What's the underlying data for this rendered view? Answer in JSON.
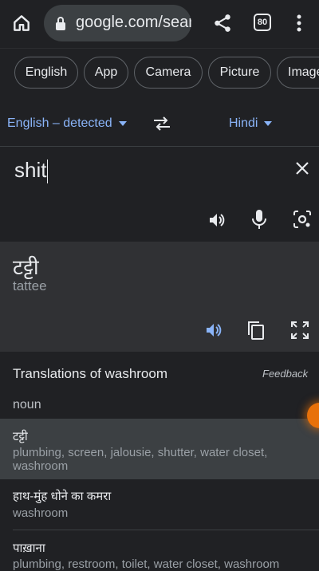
{
  "browser": {
    "url": "google.com/sear",
    "tab_count": "80"
  },
  "chips": [
    {
      "label": "English"
    },
    {
      "label": "App"
    },
    {
      "label": "Camera"
    },
    {
      "label": "Picture"
    },
    {
      "label": "Image"
    }
  ],
  "languages": {
    "source": "English – detected",
    "target": "Hindi"
  },
  "input": {
    "text": "shit"
  },
  "output": {
    "text": "टट्टी",
    "transliteration": "tattee"
  },
  "dictionary": {
    "title": "Translations of washroom",
    "feedback_label": "Feedback",
    "part_of_speech": "noun",
    "entries": [
      {
        "word": "टट्टी",
        "synonyms": "plumbing, screen, jalousie, shutter, water closet, washroom"
      },
      {
        "word": "हाथ-मुंह धोने का कमरा",
        "synonyms": "washroom"
      },
      {
        "word": "पाख़ाना",
        "synonyms": "plumbing, restroom, toilet, water closet, washroom"
      }
    ]
  },
  "colors": {
    "accent": "#8ab4f8",
    "background": "#202124",
    "output_panel": "#303134",
    "fab": "#e8710a"
  },
  "icons": [
    "home-icon",
    "lock-icon",
    "share-icon",
    "tabs-icon",
    "more-vert-icon",
    "swap-icon",
    "close-icon",
    "speaker-icon",
    "mic-icon",
    "lens-icon",
    "copy-icon",
    "fullscreen-icon"
  ]
}
